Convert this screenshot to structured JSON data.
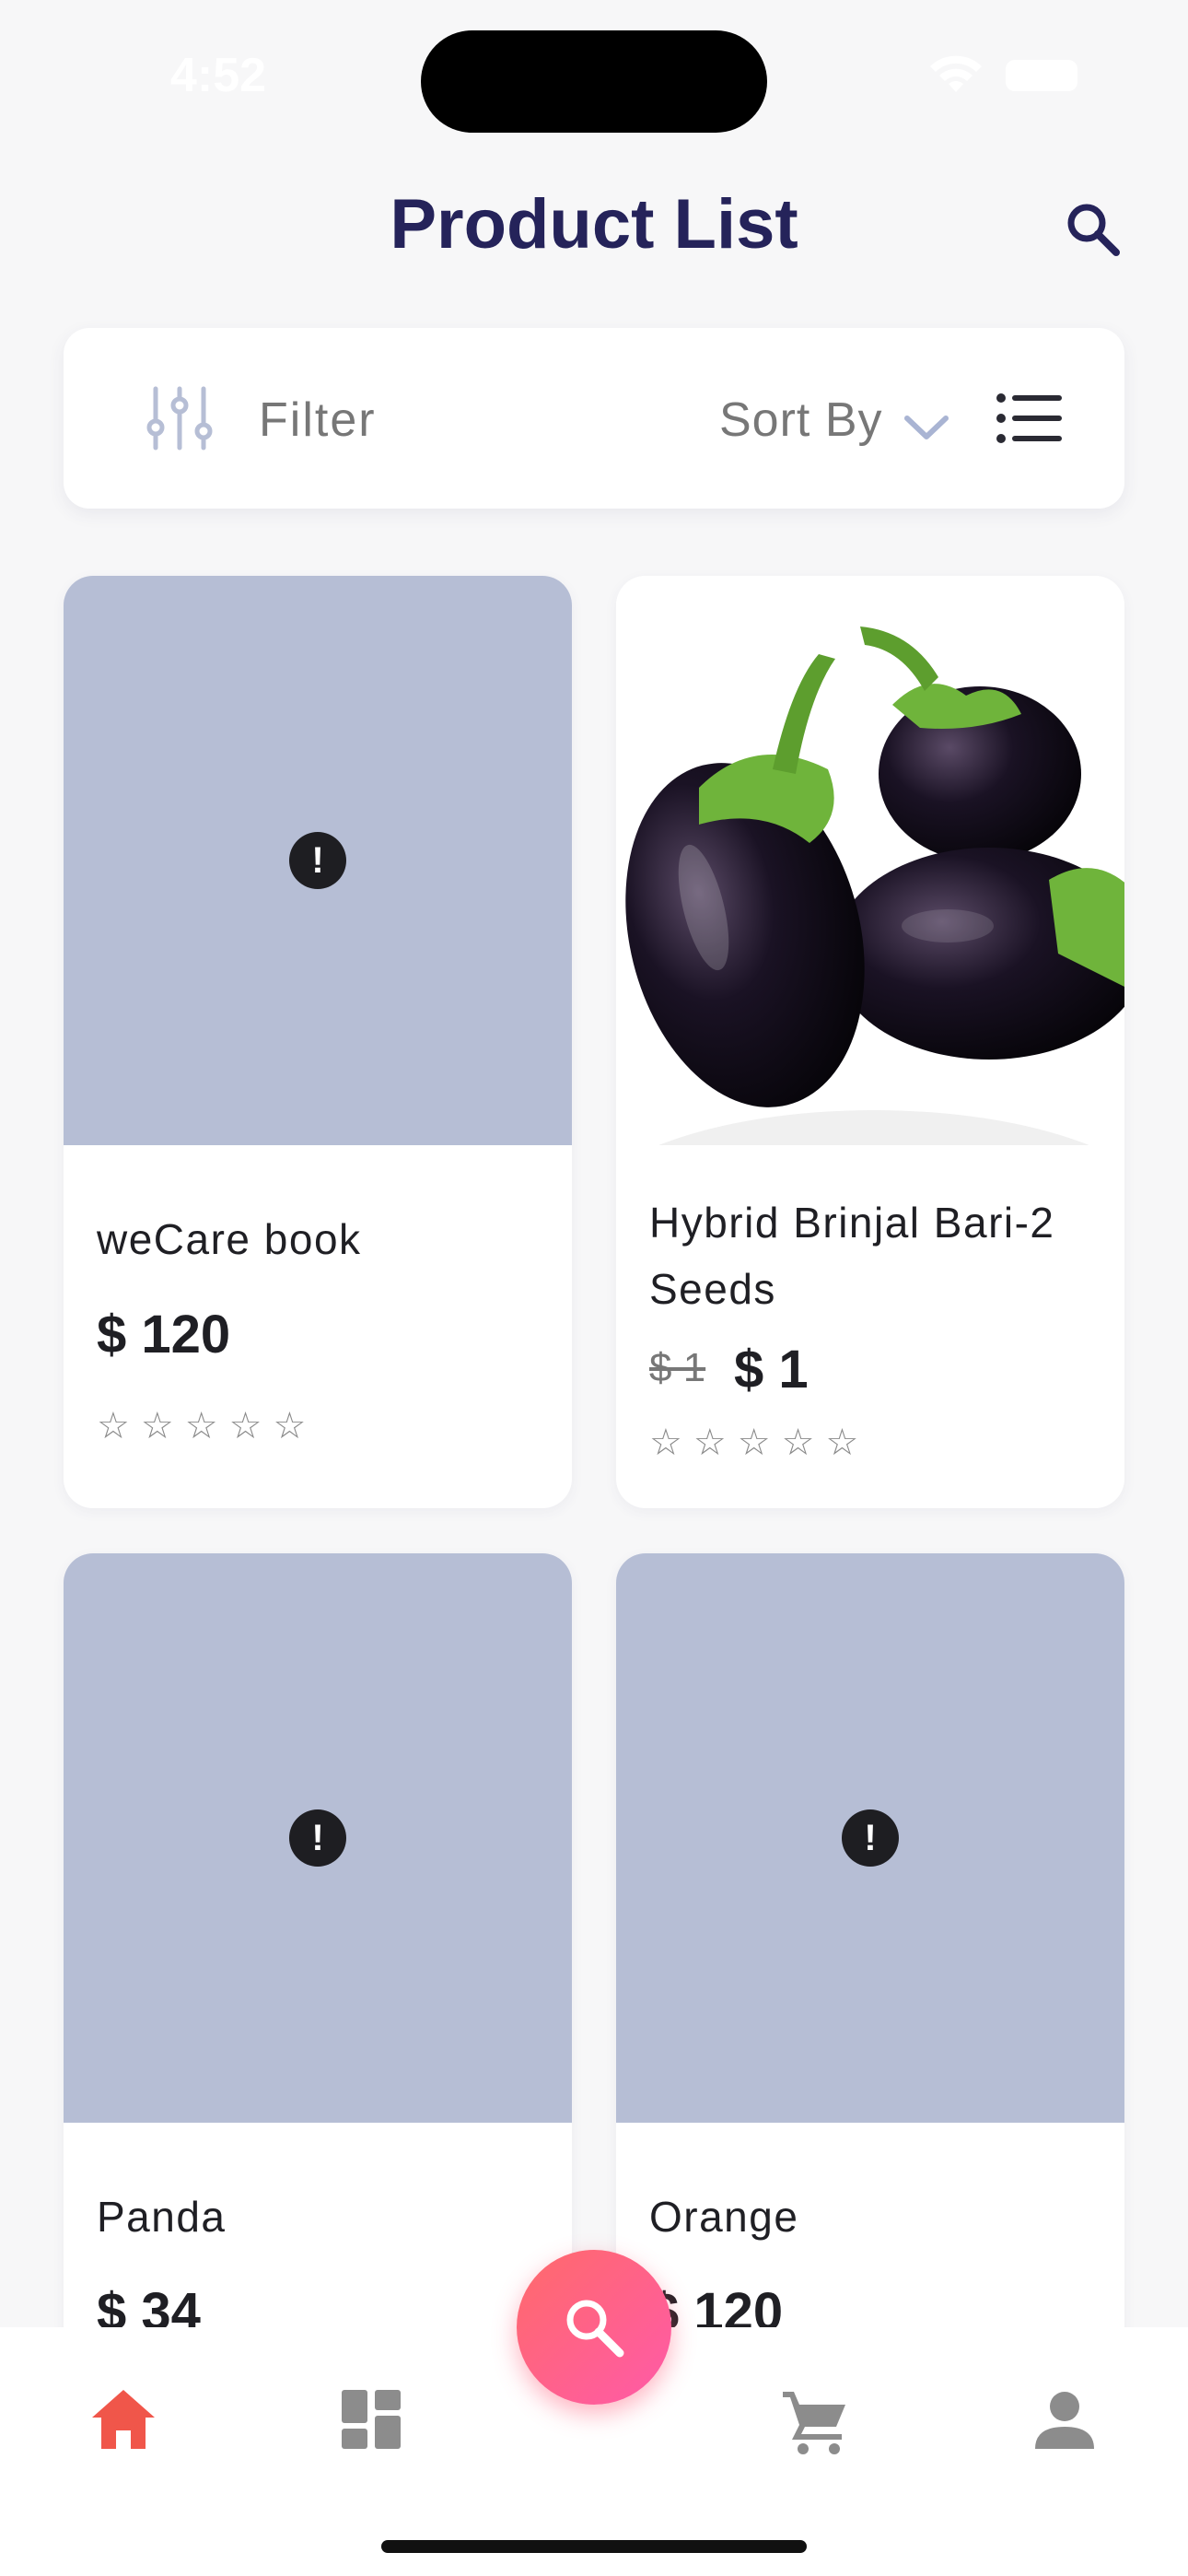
{
  "status_bar": {
    "time": "4:52"
  },
  "header": {
    "title": "Product List"
  },
  "filter_bar": {
    "filter_label": "Filter",
    "sort_label": "Sort By"
  },
  "products": [
    {
      "name": "weCare book",
      "price": "$ 120",
      "old_price": "",
      "rating": 0,
      "image": "error-icon"
    },
    {
      "name": "Hybrid Brinjal Bari-2 Seeds",
      "price": "$ 1",
      "old_price": "$ 1",
      "rating": 0,
      "image": "brinjal-photo"
    },
    {
      "name": "Panda",
      "price": "$ 34",
      "old_price": "",
      "rating": 0,
      "image": "error-icon"
    },
    {
      "name": "Orange",
      "price": "$ 120",
      "old_price": "",
      "rating": 0,
      "image": "error-icon"
    }
  ],
  "bottom_nav": {
    "items": [
      "home-icon",
      "dashboard-icon",
      "search-icon",
      "cart-icon",
      "profile-icon"
    ],
    "active": "home-icon"
  },
  "colors": {
    "accent": "#f0564a",
    "title": "#25235a",
    "placeholder": "#b6bed5",
    "fab_start": "#ff6a6a",
    "fab_end": "#ff5aa8"
  }
}
